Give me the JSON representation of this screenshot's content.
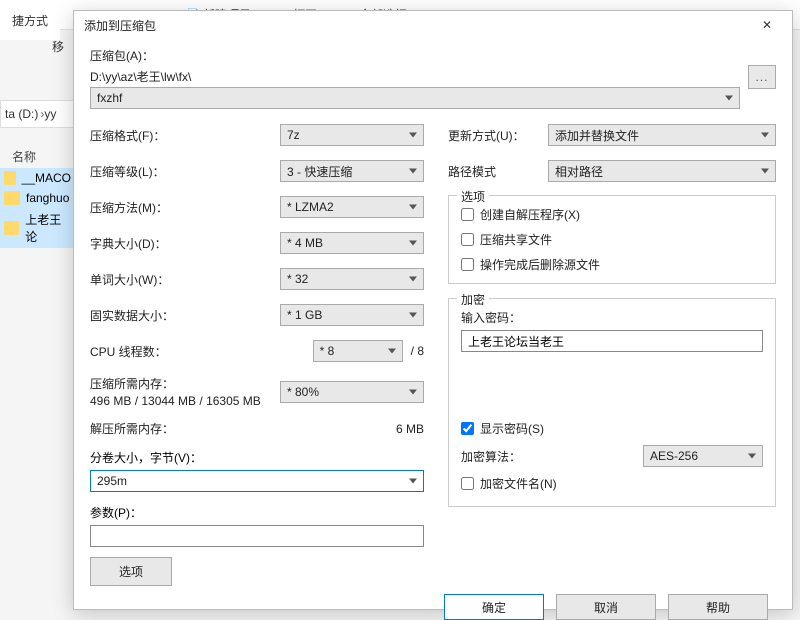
{
  "bg": {
    "shortcut": "捷方式",
    "move": "移",
    "toolbar": {
      "new": "新建项目",
      "open": "打开",
      "select_all": "全部选择"
    },
    "crumb": {
      "drive": "ta (D:)",
      "folder": "yy"
    },
    "name_header": "名称",
    "files": [
      "__MACO",
      "fanghuo",
      "上老王论"
    ]
  },
  "dialog": {
    "title": "添加到压缩包",
    "archive_label": "压缩包(A)：",
    "archive_path": "D:\\yy\\az\\老王\\lw\\fx\\",
    "archive_name": "fxzhf",
    "browse": "...",
    "left": {
      "format": {
        "label": "压缩格式(F)：",
        "value": "7z"
      },
      "level": {
        "label": "压缩等级(L)：",
        "value": "3 - 快速压缩"
      },
      "method": {
        "label": "压缩方法(M)：",
        "value": "* LZMA2"
      },
      "dict": {
        "label": "字典大小(D)：",
        "value": "* 4 MB"
      },
      "word": {
        "label": "单词大小(W)：",
        "value": "* 32"
      },
      "solid": {
        "label": "固实数据大小：",
        "value": "* 1 GB"
      },
      "threads": {
        "label": "CPU 线程数：",
        "value": "* 8",
        "max": "/ 8"
      },
      "mem_comp": {
        "label": "压缩所需内存：",
        "detail": "496 MB / 13044 MB / 16305 MB",
        "value": "* 80%"
      },
      "mem_decomp": {
        "label": "解压所需内存：",
        "value": "6 MB"
      },
      "volume": {
        "label": "分卷大小，字节(V)：",
        "value": "295m"
      },
      "params": {
        "label": "参数(P)：",
        "value": ""
      },
      "options_btn": "选项"
    },
    "right": {
      "update": {
        "label": "更新方式(U)：",
        "value": "添加并替换文件"
      },
      "path": {
        "label": "路径模式",
        "value": "相对路径"
      },
      "options": {
        "legend": "选项",
        "sfx": "创建自解压程序(X)",
        "shared": "压缩共享文件",
        "delete": "操作完成后删除源文件"
      },
      "encrypt": {
        "legend": "加密",
        "pass_label": "输入密码：",
        "pass_value": "上老王论坛当老王",
        "show_pass": "显示密码(S)",
        "algo_label": "加密算法：",
        "algo_value": "AES-256",
        "enc_names": "加密文件名(N)"
      }
    },
    "footer": {
      "ok": "确定",
      "cancel": "取消",
      "help": "帮助"
    }
  }
}
